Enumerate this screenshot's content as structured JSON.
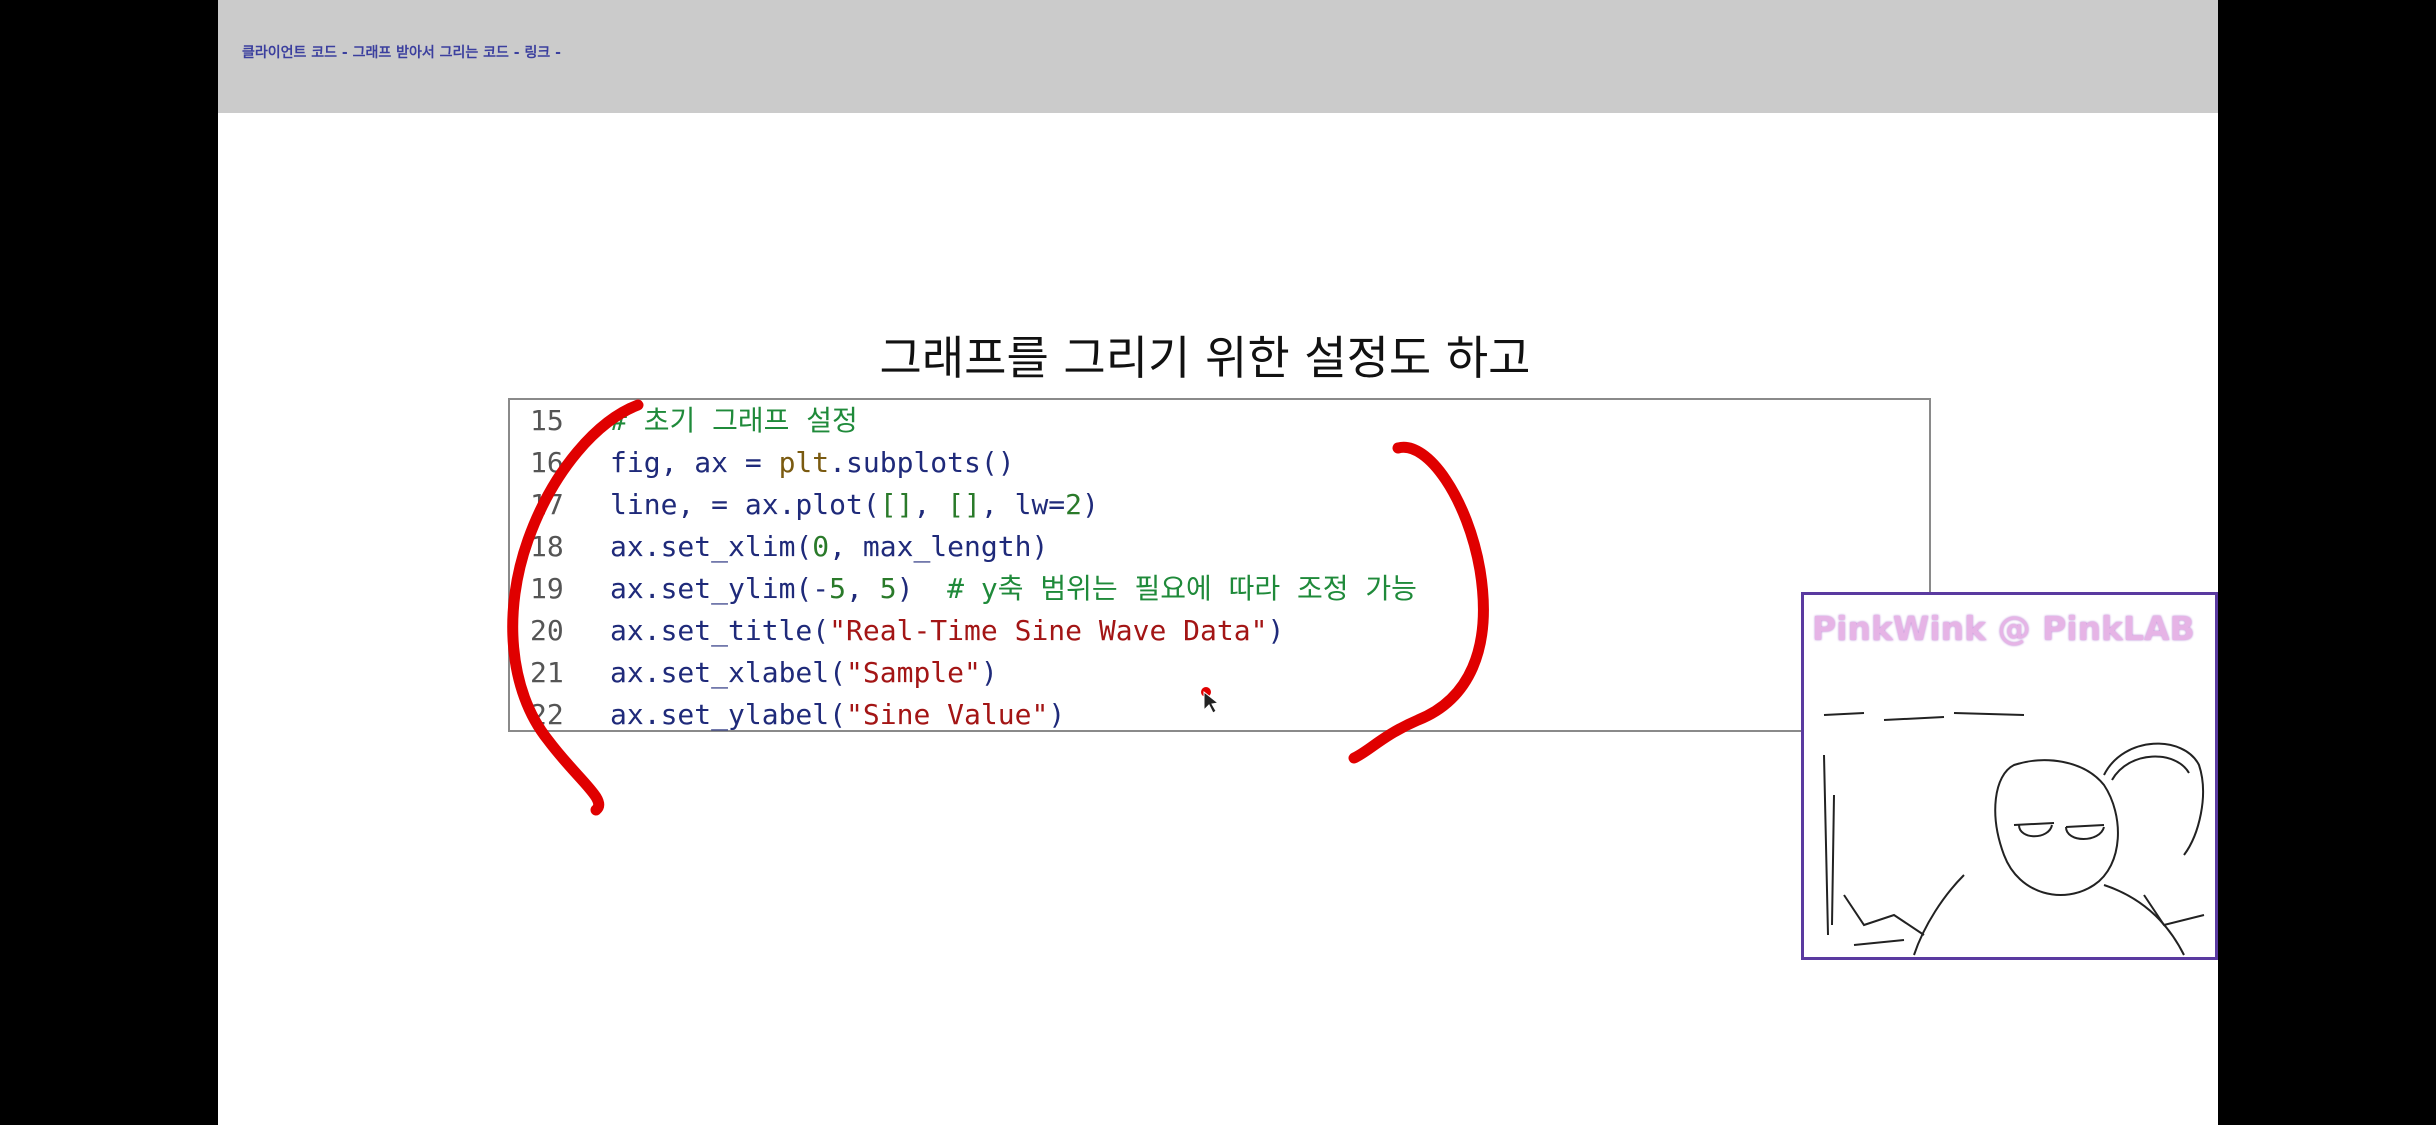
{
  "header": {
    "title": "클라이언트 코드 - 그래프 받아서 그리는 코드 - 링크 -"
  },
  "slide": {
    "title": "그래프를 그리기 위한 설정도 하고"
  },
  "code": {
    "lines": [
      {
        "num": "15",
        "parts": [
          {
            "t": "cm",
            "v": "# 초기 그래프 설정"
          }
        ]
      },
      {
        "num": "16",
        "parts": [
          {
            "t": "k",
            "v": "fig, ax = "
          },
          {
            "t": "fn",
            "v": "plt"
          },
          {
            "t": "k",
            "v": ".subplots()"
          }
        ]
      },
      {
        "num": "17",
        "parts": [
          {
            "t": "k",
            "v": "line, = ax.plot("
          },
          {
            "t": "num",
            "v": "[]"
          },
          {
            "t": "k",
            "v": ", "
          },
          {
            "t": "num",
            "v": "[]"
          },
          {
            "t": "k",
            "v": ", lw="
          },
          {
            "t": "num",
            "v": "2"
          },
          {
            "t": "k",
            "v": ")"
          }
        ]
      },
      {
        "num": "18",
        "parts": [
          {
            "t": "k",
            "v": "ax.set_xlim("
          },
          {
            "t": "num",
            "v": "0"
          },
          {
            "t": "k",
            "v": ", max_length)"
          }
        ]
      },
      {
        "num": "19",
        "parts": [
          {
            "t": "k",
            "v": "ax.set_ylim(-"
          },
          {
            "t": "num",
            "v": "5"
          },
          {
            "t": "k",
            "v": ", "
          },
          {
            "t": "num",
            "v": "5"
          },
          {
            "t": "k",
            "v": ")  "
          },
          {
            "t": "cm",
            "v": "# y축 범위는 필요에 따라 조정 가능"
          }
        ]
      },
      {
        "num": "20",
        "parts": [
          {
            "t": "k",
            "v": "ax.set_title("
          },
          {
            "t": "str",
            "v": "\"Real-Time Sine Wave Data\""
          },
          {
            "t": "k",
            "v": ")"
          }
        ]
      },
      {
        "num": "21",
        "parts": [
          {
            "t": "k",
            "v": "ax.set_xlabel("
          },
          {
            "t": "str",
            "v": "\"Sample\""
          },
          {
            "t": "k",
            "v": ")"
          }
        ]
      },
      {
        "num": "22",
        "parts": [
          {
            "t": "k",
            "v": "ax.set_ylabel("
          },
          {
            "t": "str",
            "v": "\"Sine Value\""
          },
          {
            "t": "k",
            "v": ")"
          }
        ]
      }
    ]
  },
  "webcam": {
    "label": "PinkWink @  PinkLAB"
  },
  "colors": {
    "annotation": "#e00000",
    "header_bg": "#cbcbcb",
    "webcam_border": "#5a3aa0"
  }
}
